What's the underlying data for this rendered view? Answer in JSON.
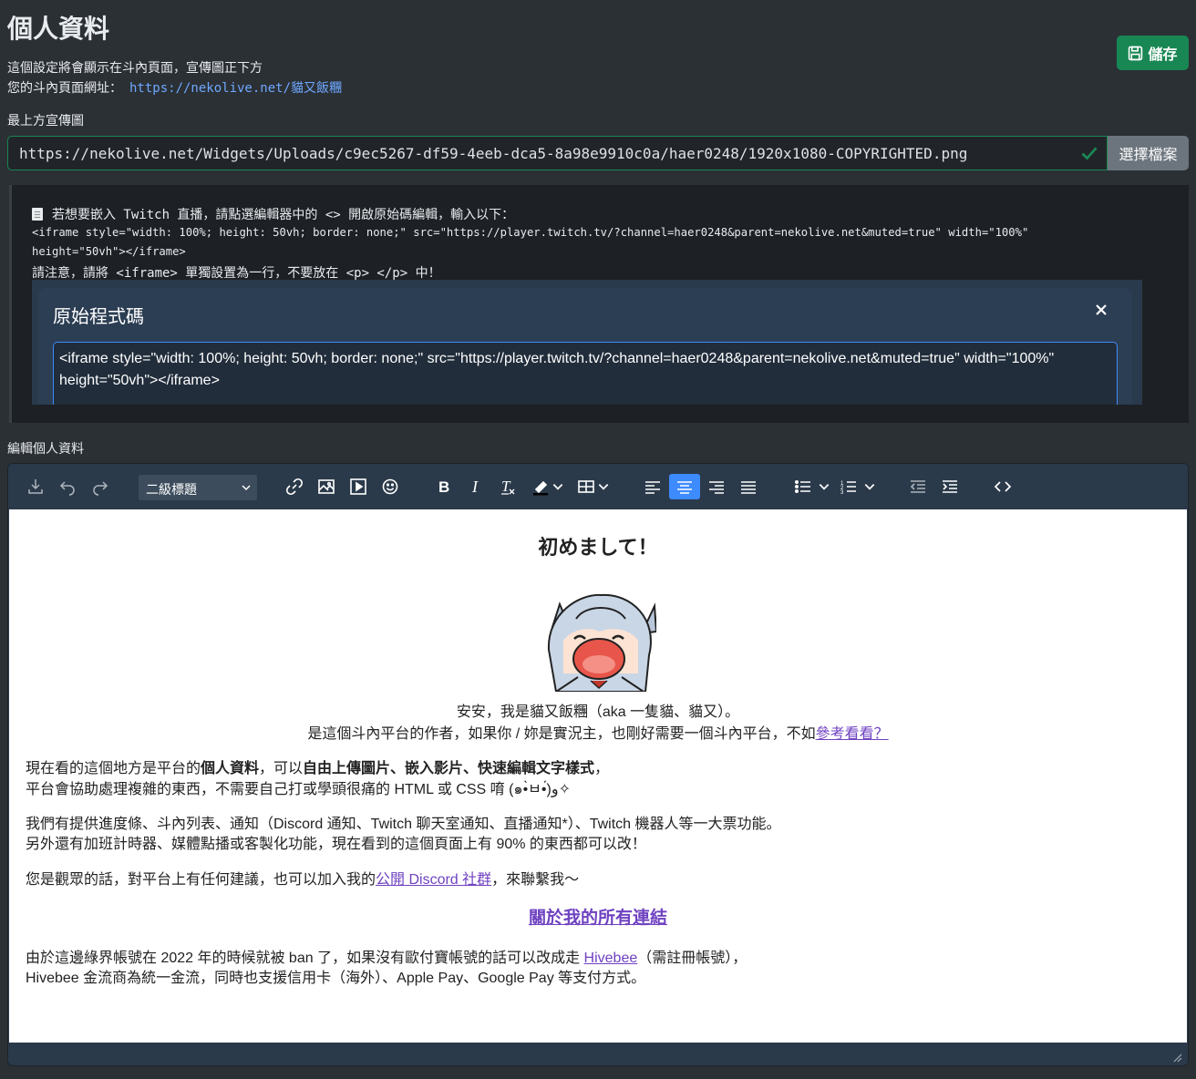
{
  "page": {
    "title": "個人資料",
    "save_label": "儲存",
    "description": "這個設定將會顯示在斗內頁面，宣傳圖正下方",
    "url_label": "您的斗內頁面網址：",
    "url_value": "https://nekolive.net/貓又飯糰"
  },
  "banner": {
    "label": "最上方宣傳圖",
    "value": "https://nekolive.net/Widgets/Uploads/c9ec5267-df59-4eeb-dca5-8a98e9910c0a/haer0248/1920x1080-COPYRIGHTED.png",
    "file_button": "選擇檔案"
  },
  "info": {
    "line1": "若想要嵌入 Twitch 直播，請點選編輯器中的 <> 開啟原始碼編輯，輸入以下：",
    "line2": "<iframe style=\"width: 100%; height: 50vh; border: none;\" src=\"https://player.twitch.tv/?channel=haer0248&parent=nekolive.net&muted=true\" width=\"100%\"",
    "line3": "height=\"50vh\"></iframe>",
    "line4": "請注意，請將 <iframe> 單獨設置為一行，不要放在 <p> </p> 中！"
  },
  "modal": {
    "title": "原始程式碼",
    "code": "<iframe style=\"width: 100%; height: 50vh; border: none;\" src=\"https://player.twitch.tv/?channel=haer0248&parent=nekolive.net&muted=true\" width=\"100%\" height=\"50vh\"></iframe>"
  },
  "editor": {
    "label": "編輯個人資料",
    "heading_select": "二級標題",
    "content": {
      "heading": "初めまして！",
      "intro1": "安安，我是貓又飯糰（aka 一隻貓、貓又）。",
      "intro2_pre": "是這個斗內平台的作者，如果你 / 妳是實況主，也剛好需要一個斗內平台，不如",
      "intro2_link": "參考看看？",
      "p1_a": "現在看的這個地方是平台的",
      "p1_b": "個人資料",
      "p1_c": "，可以",
      "p1_d": "自由上傳圖片、嵌入影片、快速編輯文字樣式",
      "p1_e": "，",
      "p1_line2": "平台會協助處理複雜的東西，不需要自己打或學頭很痛的 HTML 或 CSS 唷 (๑•̀ㅂ•́)و✧",
      "p2_line1": "我們有提供進度條、斗內列表、通知（Discord 通知、Twitch 聊天室通知、直播通知*）、Twitch 機器人等一大票功能。",
      "p2_line2": "另外還有加班計時器、媒體點播或客製化功能，現在看到的這個頁面上有 90% 的東西都可以改！",
      "p3_pre": "您是觀眾的話，對平台上有任何建議，也可以加入我的",
      "p3_link": "公開 Discord 社群",
      "p3_post": "，來聯繫我～",
      "links_heading": "關於我的所有連結",
      "p4_pre": "由於這邊綠界帳號在 2022 年的時候就被 ban 了，如果沒有歐付寶帳號的話可以改成走 ",
      "p4_link": "Hivebee",
      "p4_post": "（需註冊帳號），",
      "p4_line2": "Hivebee 金流商為統一金流，同時也支援信用卡（海外）、Apple Pay、Google Pay 等支付方式。"
    }
  },
  "colors": {
    "success": "#198754",
    "accent": "#3d8bfd",
    "link": "#6ea8fe",
    "content_link": "#6f42c1"
  }
}
